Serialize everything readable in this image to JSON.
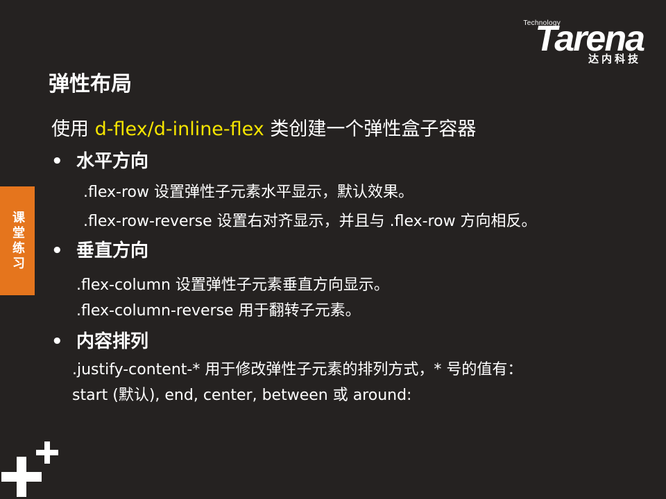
{
  "logo": {
    "tech": "Technology",
    "brand": "Tarena",
    "cn": "达内科技"
  },
  "side_tab": {
    "label": "课堂练习"
  },
  "title": "弹性布局",
  "intro": {
    "prefix": "使用 ",
    "highlight": "d-flex/d-inline-flex",
    "suffix": " 类创建一个弹性盒子容器"
  },
  "sections": {
    "horizontal": {
      "bullet": "•",
      "heading": "水平方向",
      "lines": [
        ".flex-row 设置弹性子元素水平显示，默认效果。",
        ".flex-row-reverse 设置右对齐显示，并且与 .flex-row 方向相反。"
      ]
    },
    "vertical": {
      "bullet": "•",
      "heading": "垂直方向",
      "lines": [
        ".flex-column 设置弹性子元素垂直方向显示。",
        ".flex-column-reverse 用于翻转子元素。"
      ]
    },
    "justify": {
      "bullet": "•",
      "heading": "内容排列",
      "lines": [
        ".justify-content-* 用于修改弹性子元素的排列方式，* 号的值有：",
        "start (默认), end, center, between 或 around:"
      ]
    }
  },
  "colors": {
    "background": "#252221",
    "accent_orange": "#e5751d",
    "highlight_yellow": "#f5e400",
    "text": "#ffffff"
  }
}
